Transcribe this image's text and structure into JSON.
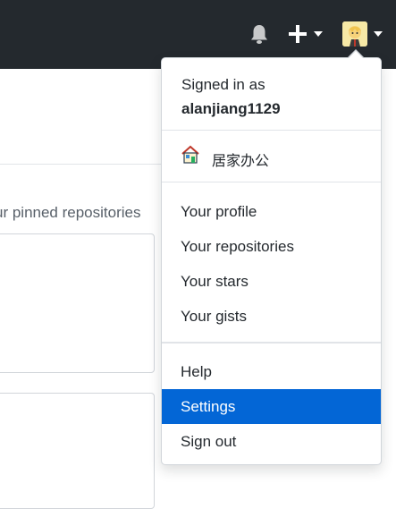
{
  "header": {
    "bell_icon": "bell-icon",
    "plus_icon": "plus-icon",
    "avatar_icon": "avatar-icon"
  },
  "background": {
    "pinned_text": "ur pinned repositories"
  },
  "dropdown": {
    "signed_in_label": "Signed in as",
    "username": "alanjiang1129",
    "status": {
      "emoji": "house-icon",
      "text": "居家办公"
    },
    "items": [
      {
        "label": "Your profile"
      },
      {
        "label": "Your repositories"
      },
      {
        "label": "Your stars"
      },
      {
        "label": "Your gists"
      },
      {
        "label": "Help"
      },
      {
        "label": "Settings"
      },
      {
        "label": "Sign out"
      }
    ],
    "active_item": "Settings",
    "accent_color": "#0366d6"
  }
}
